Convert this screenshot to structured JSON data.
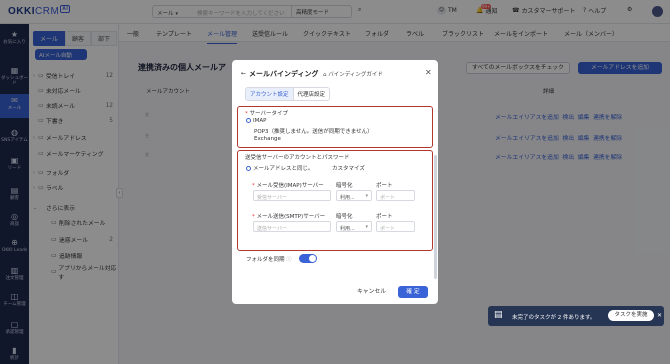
{
  "topbar": {
    "logo_main": "OKKI",
    "logo_crm": "CRM",
    "logo_ai": "AI",
    "search_scope": "メール",
    "search_placeholder": "検索キーワードを入力してください",
    "search_mode": "高精度モード",
    "tm": "TM",
    "notice": "通知",
    "notice_badge": "99+",
    "support": "カスタマーサポート",
    "help": "ヘルプ"
  },
  "rail": {
    "items": [
      {
        "label": "お気に入り",
        "icon": "star-icon"
      },
      {
        "label": "ダッシュボード",
        "icon": "dashboard-icon"
      },
      {
        "label": "メール",
        "icon": "mail-icon"
      },
      {
        "label": "SNSアイテム",
        "icon": "sns-icon"
      },
      {
        "label": "リード",
        "icon": "lead-icon"
      },
      {
        "label": "顧客",
        "icon": "customer-icon"
      },
      {
        "label": "商談",
        "icon": "deal-icon"
      },
      {
        "label": "OKKI Leads",
        "icon": "leads-icon"
      },
      {
        "label": "注文管理",
        "icon": "order-icon"
      },
      {
        "label": "チーム管理",
        "icon": "team-icon"
      },
      {
        "label": "承認管理",
        "icon": "approval-icon"
      },
      {
        "label": "統計",
        "icon": "stats-icon"
      }
    ]
  },
  "mail_sidebar": {
    "tabs": [
      "メール",
      "顧客",
      "部下"
    ],
    "ai_button": "AIメール自動",
    "items": [
      {
        "label": "受信トレイ",
        "count": "12"
      },
      {
        "label": "未対応メール",
        "count": ""
      },
      {
        "label": "未読メール",
        "count": "12"
      },
      {
        "label": "下書き",
        "count": "5"
      },
      {
        "label": "メールアドレス",
        "count": ""
      },
      {
        "label": "メールマーケティング",
        "count": ""
      },
      {
        "label": "フォルダ",
        "count": ""
      },
      {
        "label": "ラベル",
        "count": ""
      },
      {
        "label": "さらに表示",
        "count": ""
      },
      {
        "label": "削除されたメール",
        "count": ""
      },
      {
        "label": "迷惑メール",
        "count": "2"
      },
      {
        "label": "追跡情報",
        "count": ""
      },
      {
        "label": "アプリからメール対応す",
        "count": ""
      }
    ]
  },
  "content_tabs": [
    "一般",
    "テンプレート",
    "メール管理",
    "送受信ルール",
    "クイックテキスト",
    "フォルダ",
    "ラベル",
    "ブラックリスト",
    "メールをインポート",
    "メール（メンバー）"
  ],
  "page": {
    "title": "連携済みの個人メールア",
    "check_button": "すべてのメールボックスをチェック",
    "add_button": "メールアドレスを追加",
    "col_account": "メールアカウント",
    "col_detail": "詳細",
    "row_actions": [
      "メールエイリアスを追加",
      "検出",
      "編集",
      "連携を解除"
    ]
  },
  "modal": {
    "back": "←",
    "title": "メールバインディング",
    "guide": "バインディングガイド",
    "close": "✕",
    "tabs": [
      "アカウント設定",
      "代理店設定"
    ],
    "server_type_label": "サーバータイプ",
    "server_options": [
      {
        "label": "IMAP",
        "selected": true
      },
      {
        "label": "POP3（推奨しません。送信が同期できません）",
        "selected": false
      },
      {
        "label": "Exchange",
        "selected": false
      }
    ],
    "account_section_label": "送受信サーバーのアカウントとパスワード",
    "same_as_email": "メールアドレスと同じ。",
    "customize": "カスタマイズ",
    "imap_label": "メール受信(IMAP)サーバー",
    "imap_placeholder": "受信サーバー",
    "smtp_label": "メール送信(SMTP)サーバー",
    "smtp_placeholder": "送信サーバー",
    "encryption_label": "暗号化",
    "encryption_value": "利用...",
    "port_label": "ポート",
    "port_placeholder": "ポート",
    "folder_sync_label": "フォルダを同期",
    "cancel": "キャンセル",
    "ok": "確 定"
  },
  "toast": {
    "text": "未完了のタスクが 2 件あります。",
    "button": "タスクを実施",
    "close": "✕"
  },
  "colors": {
    "accent": "#3a63d8",
    "rail": "#1e2a4f",
    "highlight": "#b2382e"
  }
}
